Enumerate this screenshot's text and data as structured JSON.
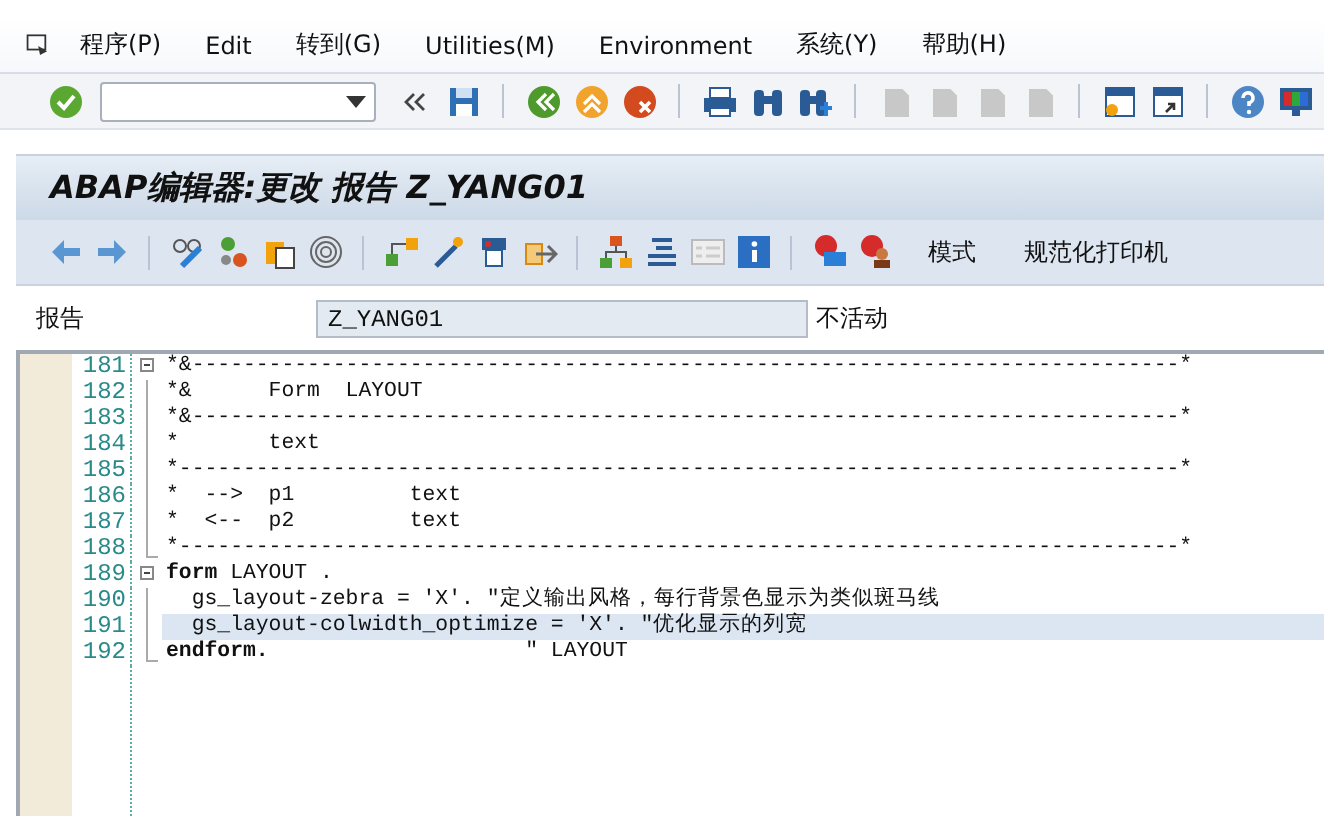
{
  "menu": [
    {
      "label": "程序(P)"
    },
    {
      "label": "Edit"
    },
    {
      "label": "转到(G)"
    },
    {
      "label": "Utilities(M)"
    },
    {
      "label": "Environment"
    },
    {
      "label": "系统(Y)"
    },
    {
      "label": "帮助(H)"
    }
  ],
  "standard_toolbar": [
    {
      "kind": "button",
      "disabled": false
    },
    {
      "kind": "command-field"
    },
    {
      "kind": "button",
      "disabled": false
    },
    {
      "kind": "button",
      "disabled": false
    },
    {
      "kind": "separator"
    },
    {
      "kind": "button",
      "disabled": false
    },
    {
      "kind": "button",
      "disabled": false
    },
    {
      "kind": "button",
      "disabled": false
    },
    {
      "kind": "separator"
    },
    {
      "kind": "button",
      "disabled": false
    },
    {
      "kind": "button",
      "disabled": false
    },
    {
      "kind": "button",
      "disabled": false
    },
    {
      "kind": "separator"
    },
    {
      "kind": "button",
      "disabled": true
    },
    {
      "kind": "button",
      "disabled": true
    },
    {
      "kind": "button",
      "disabled": true
    },
    {
      "kind": "button",
      "disabled": true
    },
    {
      "kind": "separator"
    },
    {
      "kind": "button",
      "disabled": false
    },
    {
      "kind": "button",
      "disabled": false
    },
    {
      "kind": "separator"
    },
    {
      "kind": "button",
      "disabled": false
    },
    {
      "kind": "button",
      "disabled": false
    }
  ],
  "title": "ABAP编辑器:更改 报告 Z_YANG01",
  "app_toolbar": [
    {
      "kind": "icon"
    },
    {
      "kind": "icon"
    },
    {
      "kind": "separator"
    },
    {
      "kind": "icon"
    },
    {
      "kind": "icon"
    },
    {
      "kind": "icon"
    },
    {
      "kind": "icon"
    },
    {
      "kind": "separator"
    },
    {
      "kind": "icon"
    },
    {
      "kind": "icon"
    },
    {
      "kind": "icon"
    },
    {
      "kind": "icon"
    },
    {
      "kind": "separator"
    },
    {
      "kind": "icon"
    },
    {
      "kind": "icon"
    },
    {
      "kind": "icon"
    },
    {
      "kind": "icon"
    },
    {
      "kind": "separator"
    },
    {
      "kind": "icon"
    },
    {
      "kind": "icon"
    },
    {
      "kind": "text",
      "label": "模式"
    },
    {
      "kind": "text",
      "label": "规范化打印机"
    }
  ],
  "report_field": {
    "label": "报告",
    "value": "Z_YANG01",
    "status": "不活动"
  },
  "editor": {
    "lines": [
      {
        "number": "181",
        "kind": "fold-start",
        "current": false,
        "text": "*&-----------------------------------------------------------------------------*"
      },
      {
        "number": "182",
        "kind": "fold-inner",
        "current": false,
        "text": "*&      Form  LAYOUT"
      },
      {
        "number": "183",
        "kind": "fold-inner",
        "current": false,
        "text": "*&-----------------------------------------------------------------------------*"
      },
      {
        "number": "184",
        "kind": "fold-inner",
        "current": false,
        "text": "*       text"
      },
      {
        "number": "185",
        "kind": "fold-inner",
        "current": false,
        "text": "*------------------------------------------------------------------------------*"
      },
      {
        "number": "186",
        "kind": "fold-inner",
        "current": false,
        "text": "*  -->  p1         text"
      },
      {
        "number": "187",
        "kind": "fold-inner",
        "current": false,
        "text": "*  <--  p2         text"
      },
      {
        "number": "188",
        "kind": "fold-end",
        "current": false,
        "text": "*------------------------------------------------------------------------------*"
      },
      {
        "number": "189",
        "kind": "fold-start",
        "current": false,
        "keyword": "form",
        "text": " LAYOUT ."
      },
      {
        "number": "190",
        "kind": "fold-inner",
        "current": false,
        "text": "  gs_layout-zebra = 'X'. \"定义输出风格，每行背景色显示为类似斑马线"
      },
      {
        "number": "191",
        "kind": "fold-inner",
        "current": true,
        "text": "  gs_layout-colwidth_optimize = 'X'. \"优化显示的列宽"
      },
      {
        "number": "192",
        "kind": "fold-end",
        "current": false,
        "keyword": "endform.",
        "text": "                    \" LAYOUT"
      }
    ]
  }
}
